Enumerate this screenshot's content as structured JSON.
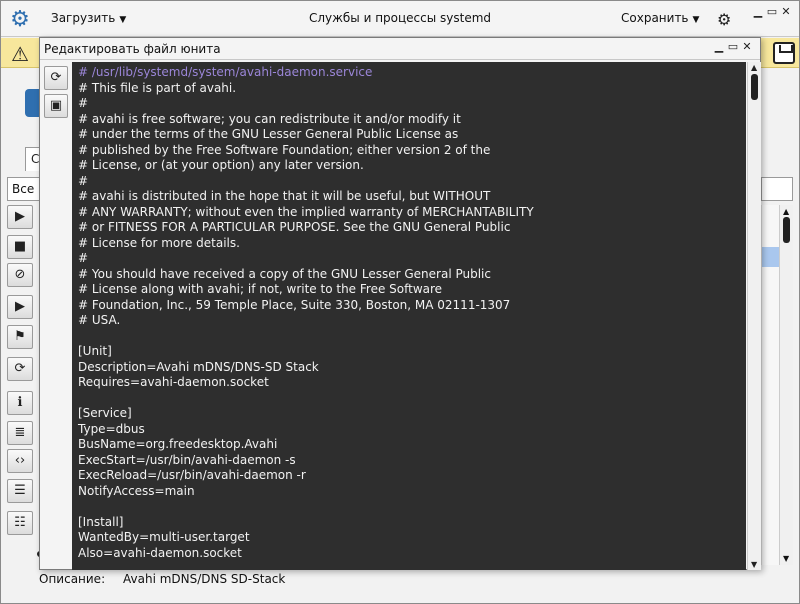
{
  "main": {
    "title": "Службы и процессы systemd",
    "menu_load": "Загрузить",
    "menu_save": "Сохранить",
    "arrow": "▼",
    "controls": {
      "minimize": "▁",
      "maximize": "▭",
      "close": "✕"
    }
  },
  "background": {
    "tab_label": "С",
    "filter_value": "Все",
    "description_label": "Описание:",
    "description_value": "Avahi mDNS/DNS SD-Stack"
  },
  "action_buttons": [
    {
      "name": "start-service-button",
      "icon": "play-circle-icon",
      "glyph": "▶"
    },
    {
      "name": "stop-service-button",
      "icon": "stop-circle-icon",
      "glyph": "■"
    },
    {
      "name": "disable-service-button",
      "icon": "forbidden-icon",
      "glyph": "⊘"
    },
    {
      "name": "run-button",
      "icon": "play-icon",
      "glyph": "▶"
    },
    {
      "name": "flags-button",
      "icon": "flag-icon",
      "glyph": "⚑"
    },
    {
      "name": "restart-service-button",
      "icon": "refresh-icon",
      "glyph": "⟳"
    },
    {
      "name": "info-button",
      "icon": "info-icon",
      "glyph": "ℹ"
    },
    {
      "name": "view-file-button",
      "icon": "document-icon",
      "glyph": "≣"
    },
    {
      "name": "edit-source-button",
      "icon": "code-file-icon",
      "glyph": "‹›"
    },
    {
      "name": "log-button",
      "icon": "terminal-icon",
      "glyph": "☰"
    },
    {
      "name": "list-button",
      "icon": "list-icon",
      "glyph": "☷"
    }
  ],
  "dialog": {
    "title": "Редактировать файл юнита",
    "controls": {
      "minimize": "▁",
      "maximize": "▭",
      "close": "✕"
    },
    "side_buttons": [
      {
        "name": "reload-button",
        "icon": "refresh-icon",
        "glyph": "⟳"
      },
      {
        "name": "save-file-button",
        "icon": "save-icon",
        "glyph": "▣"
      }
    ]
  },
  "editor": {
    "lines": [
      "# /usr/lib/systemd/system/avahi-daemon.service",
      "# This file is part of avahi.",
      "#",
      "# avahi is free software; you can redistribute it and/or modify it",
      "# under the terms of the GNU Lesser General Public License as",
      "# published by the Free Software Foundation; either version 2 of the",
      "# License, or (at your option) any later version.",
      "#",
      "# avahi is distributed in the hope that it will be useful, but WITHOUT",
      "# ANY WARRANTY; without even the implied warranty of MERCHANTABILITY",
      "# or FITNESS FOR A PARTICULAR PURPOSE. See the GNU General Public",
      "# License for more details.",
      "#",
      "# You should have received a copy of the GNU Lesser General Public",
      "# License along with avahi; if not, write to the Free Software",
      "# Foundation, Inc., 59 Temple Place, Suite 330, Boston, MA 02111-1307",
      "# USA.",
      "",
      "[Unit]",
      "Description=Avahi mDNS/DNS-SD Stack",
      "Requires=avahi-daemon.socket",
      "",
      "[Service]",
      "Type=dbus",
      "BusName=org.freedesktop.Avahi",
      "ExecStart=/usr/bin/avahi-daemon -s",
      "ExecReload=/usr/bin/avahi-daemon -r",
      "NotifyAccess=main",
      "",
      "[Install]",
      "WantedBy=multi-user.target",
      "Also=avahi-daemon.socket"
    ]
  }
}
